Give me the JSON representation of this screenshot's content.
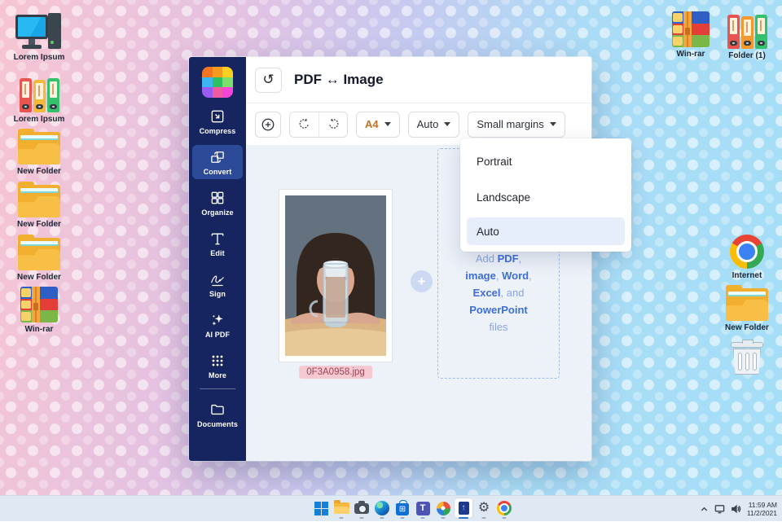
{
  "desktop": {
    "left_icons": [
      {
        "label": "Lorem Ipsum"
      },
      {
        "label": "Lorem Ipsum"
      },
      {
        "label": "New Folder"
      },
      {
        "label": "New Folder"
      },
      {
        "label": "New Folder"
      },
      {
        "label": "Win-rar"
      }
    ],
    "top_right_icons": [
      {
        "label": "Win-rar"
      },
      {
        "label": "Folder (1)"
      }
    ],
    "right_icons": [
      {
        "label": "Internet"
      },
      {
        "label": "New Folder"
      }
    ]
  },
  "window": {
    "title": "PDF ↔ Image",
    "back_glyph": "↺",
    "sidebar": {
      "items": [
        {
          "label": "Compress"
        },
        {
          "label": "Convert"
        },
        {
          "label": "Organize"
        },
        {
          "label": "Edit"
        },
        {
          "label": "Sign"
        },
        {
          "label": "AI PDF"
        },
        {
          "label": "More"
        },
        {
          "label": "Documents"
        }
      ]
    },
    "toolbar": {
      "page_size": "A4",
      "orientation": "Auto",
      "margins": "Small margins"
    },
    "dropdown": {
      "options": [
        "Portrait",
        "Landscape",
        "Auto"
      ],
      "selected": "Auto"
    },
    "file": {
      "name": "0F3A0958.jpg"
    },
    "add_area": {
      "plus": "+",
      "t_add": "Add ",
      "t_pdf": "PDF",
      "t_c1": ", ",
      "t_image": "image",
      "t_c2": ", ",
      "t_word": "Word",
      "t_c3": ", ",
      "t_excel": "Excel",
      "t_and": ", and ",
      "t_ppt": "PowerPoint",
      "t_files": "files"
    }
  },
  "taskbar": {
    "time": "11:59 AM",
    "date": "11/2/2021"
  },
  "colors": {
    "sidebar": "#16255f",
    "sidebar_active": "#2d4a99",
    "accent_blue": "#3d6fd6",
    "badge_bg": "#f6c9d2",
    "badge_text": "#9c4352",
    "a4_text": "#bf7222",
    "content_bg": "#edf1f8"
  }
}
